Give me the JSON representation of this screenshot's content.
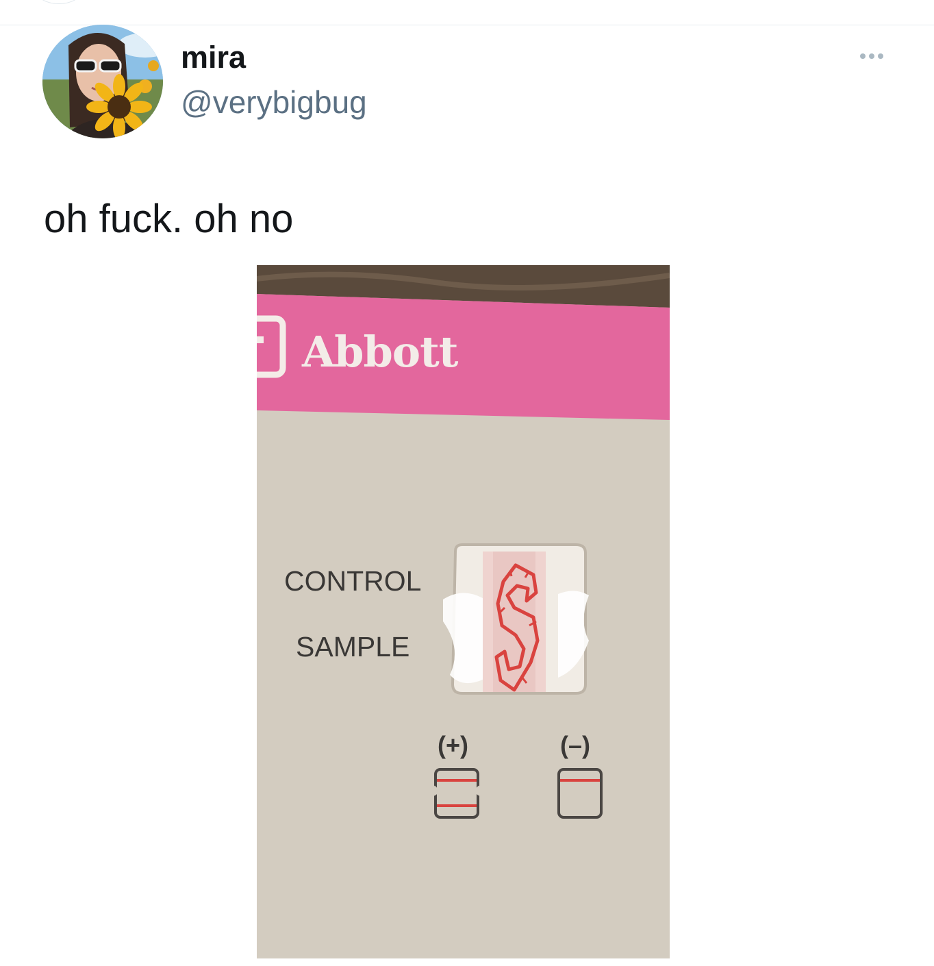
{
  "tweet": {
    "author": {
      "display_name": "mira",
      "handle": "@verybigbug",
      "avatar_icon": "profile-photo-with-sunflower"
    },
    "more_icon": "more-dots-icon",
    "text": "oh fuck. oh no",
    "photo": {
      "brand": "Abbott",
      "labels": {
        "control": "CONTROL",
        "sample": "SAMPLE",
        "positive": "(+)",
        "negative": "(–)"
      },
      "colors": {
        "brand_band": "#e3679d",
        "card": "#d3ccc0",
        "line_red": "#d9433f"
      }
    }
  }
}
